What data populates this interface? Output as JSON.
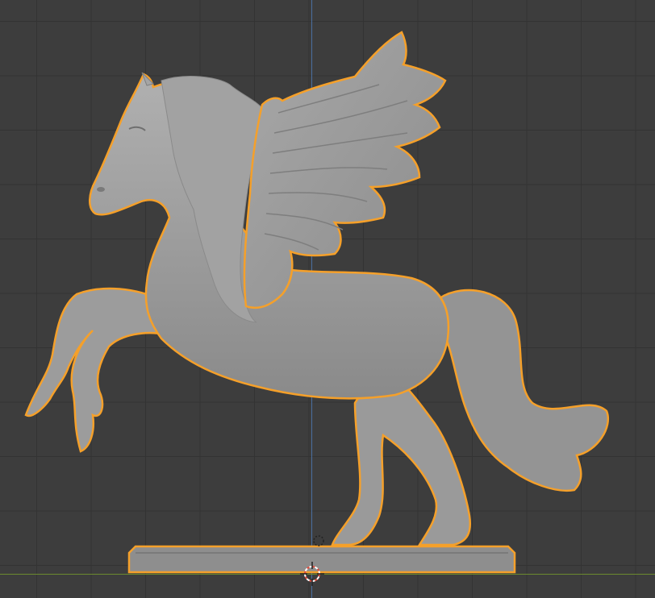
{
  "viewport": {
    "background": "#3d3d3d",
    "grid_color": "#333333",
    "axis_x_color": "#6b8a2e",
    "axis_y_color": "#4a6fa0"
  },
  "object": {
    "name_hidden": true,
    "selected": true,
    "outline_color": "#f5a02a",
    "mesh_color": "#9a9a9a"
  },
  "icons": {
    "cursor": "3d-cursor-icon",
    "origin": "object-origin-icon"
  }
}
